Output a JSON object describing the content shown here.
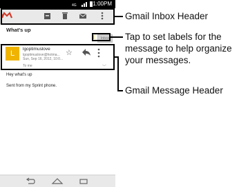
{
  "status_bar": {
    "time": "1:00PM",
    "network": "4G LTE"
  },
  "action_bar": {
    "app_icon": "gmail-logo-icon",
    "actions": [
      "archive-icon",
      "delete-icon",
      "mark-unread-icon",
      "overflow-menu-icon"
    ]
  },
  "message": {
    "subject": "What's up",
    "label_button": "Inbox",
    "sender_name": "lgoptimuslove",
    "sender_email": "lgoptimuslove@hotma...",
    "date": "Sun, Sep 16, 2012, 10:0...",
    "to_line": "To me",
    "body_lines": [
      "Hey what's up",
      "Sent from my Sprint phone."
    ]
  },
  "annotations": {
    "inbox_header": "Gmail Inbox Header",
    "labels_tip": "Tap to set labels for the message to help organize your messages.",
    "message_header": "Gmail Message Header"
  },
  "colors": {
    "avatar": "#f0b400",
    "gmail_red": "#d23b2b"
  }
}
